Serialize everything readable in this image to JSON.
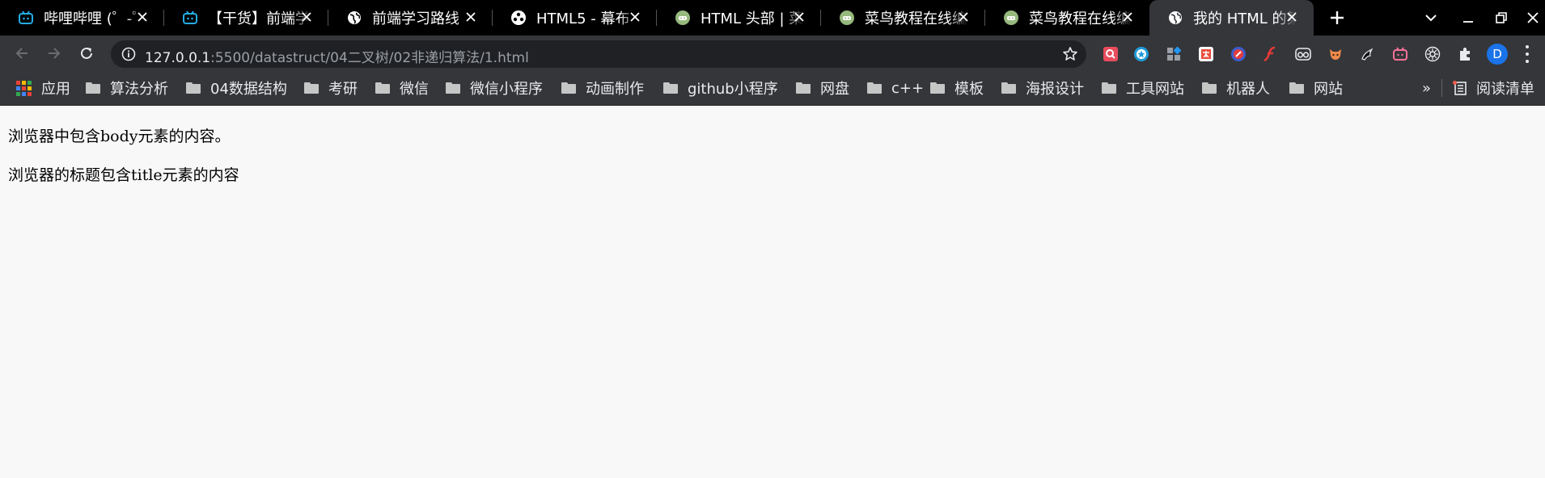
{
  "tabs": [
    {
      "title": "哔哩哔哩 (゜-゜",
      "icon": "bilibili-icon",
      "active": false
    },
    {
      "title": "【干货】前端学",
      "icon": "bilibili-icon",
      "active": false
    },
    {
      "title": "前端学习路线",
      "icon": "globe-icon",
      "active": false
    },
    {
      "title": "HTML5 - 幕布",
      "icon": "mubu-icon",
      "active": false
    },
    {
      "title": "HTML 头部 | 菜",
      "icon": "runoob-icon",
      "active": false
    },
    {
      "title": "菜鸟教程在线编",
      "icon": "runoob-icon",
      "active": false
    },
    {
      "title": "菜鸟教程在线编",
      "icon": "runoob-icon",
      "active": false
    },
    {
      "title": "我的 HTML 的第",
      "icon": "globe-icon",
      "active": true
    }
  ],
  "address_bar": {
    "host": "127.0.0.1",
    "path": ":5500/datastruct/04二叉树/02非递归算法/1.html"
  },
  "profile": {
    "initial": "D",
    "color": "#1a73e8"
  },
  "extensions": [
    "search-ext-icon",
    "star-ext-icon",
    "grid-ext-icon",
    "translate-ext-icon",
    "flash-ext-icon",
    "flash-player-ext-icon",
    "glasses-ext-icon",
    "fox-ext-icon",
    "bird-ext-icon",
    "bilibili-ext-icon",
    "settings-ext-icon",
    "puzzle-icon"
  ],
  "bookmarks": {
    "apps_label": "应用",
    "folders": [
      "算法分析",
      "04数据结构",
      "考研",
      "微信",
      "微信小程序",
      "动画制作",
      "github小程序",
      "网盘",
      "c++",
      "模板",
      "海报设计",
      "工具网站",
      "机器人",
      "网站"
    ],
    "overflow": "»",
    "reading_list": "阅读清单"
  },
  "page": {
    "lines": [
      "浏览器中包含body元素的内容。",
      "浏览器的标题包含title元素的内容"
    ]
  },
  "colors": {
    "tabstrip": "#000000",
    "toolbar": "#35363a",
    "omnibox": "#202124",
    "page_bg": "#f8f8f8"
  }
}
